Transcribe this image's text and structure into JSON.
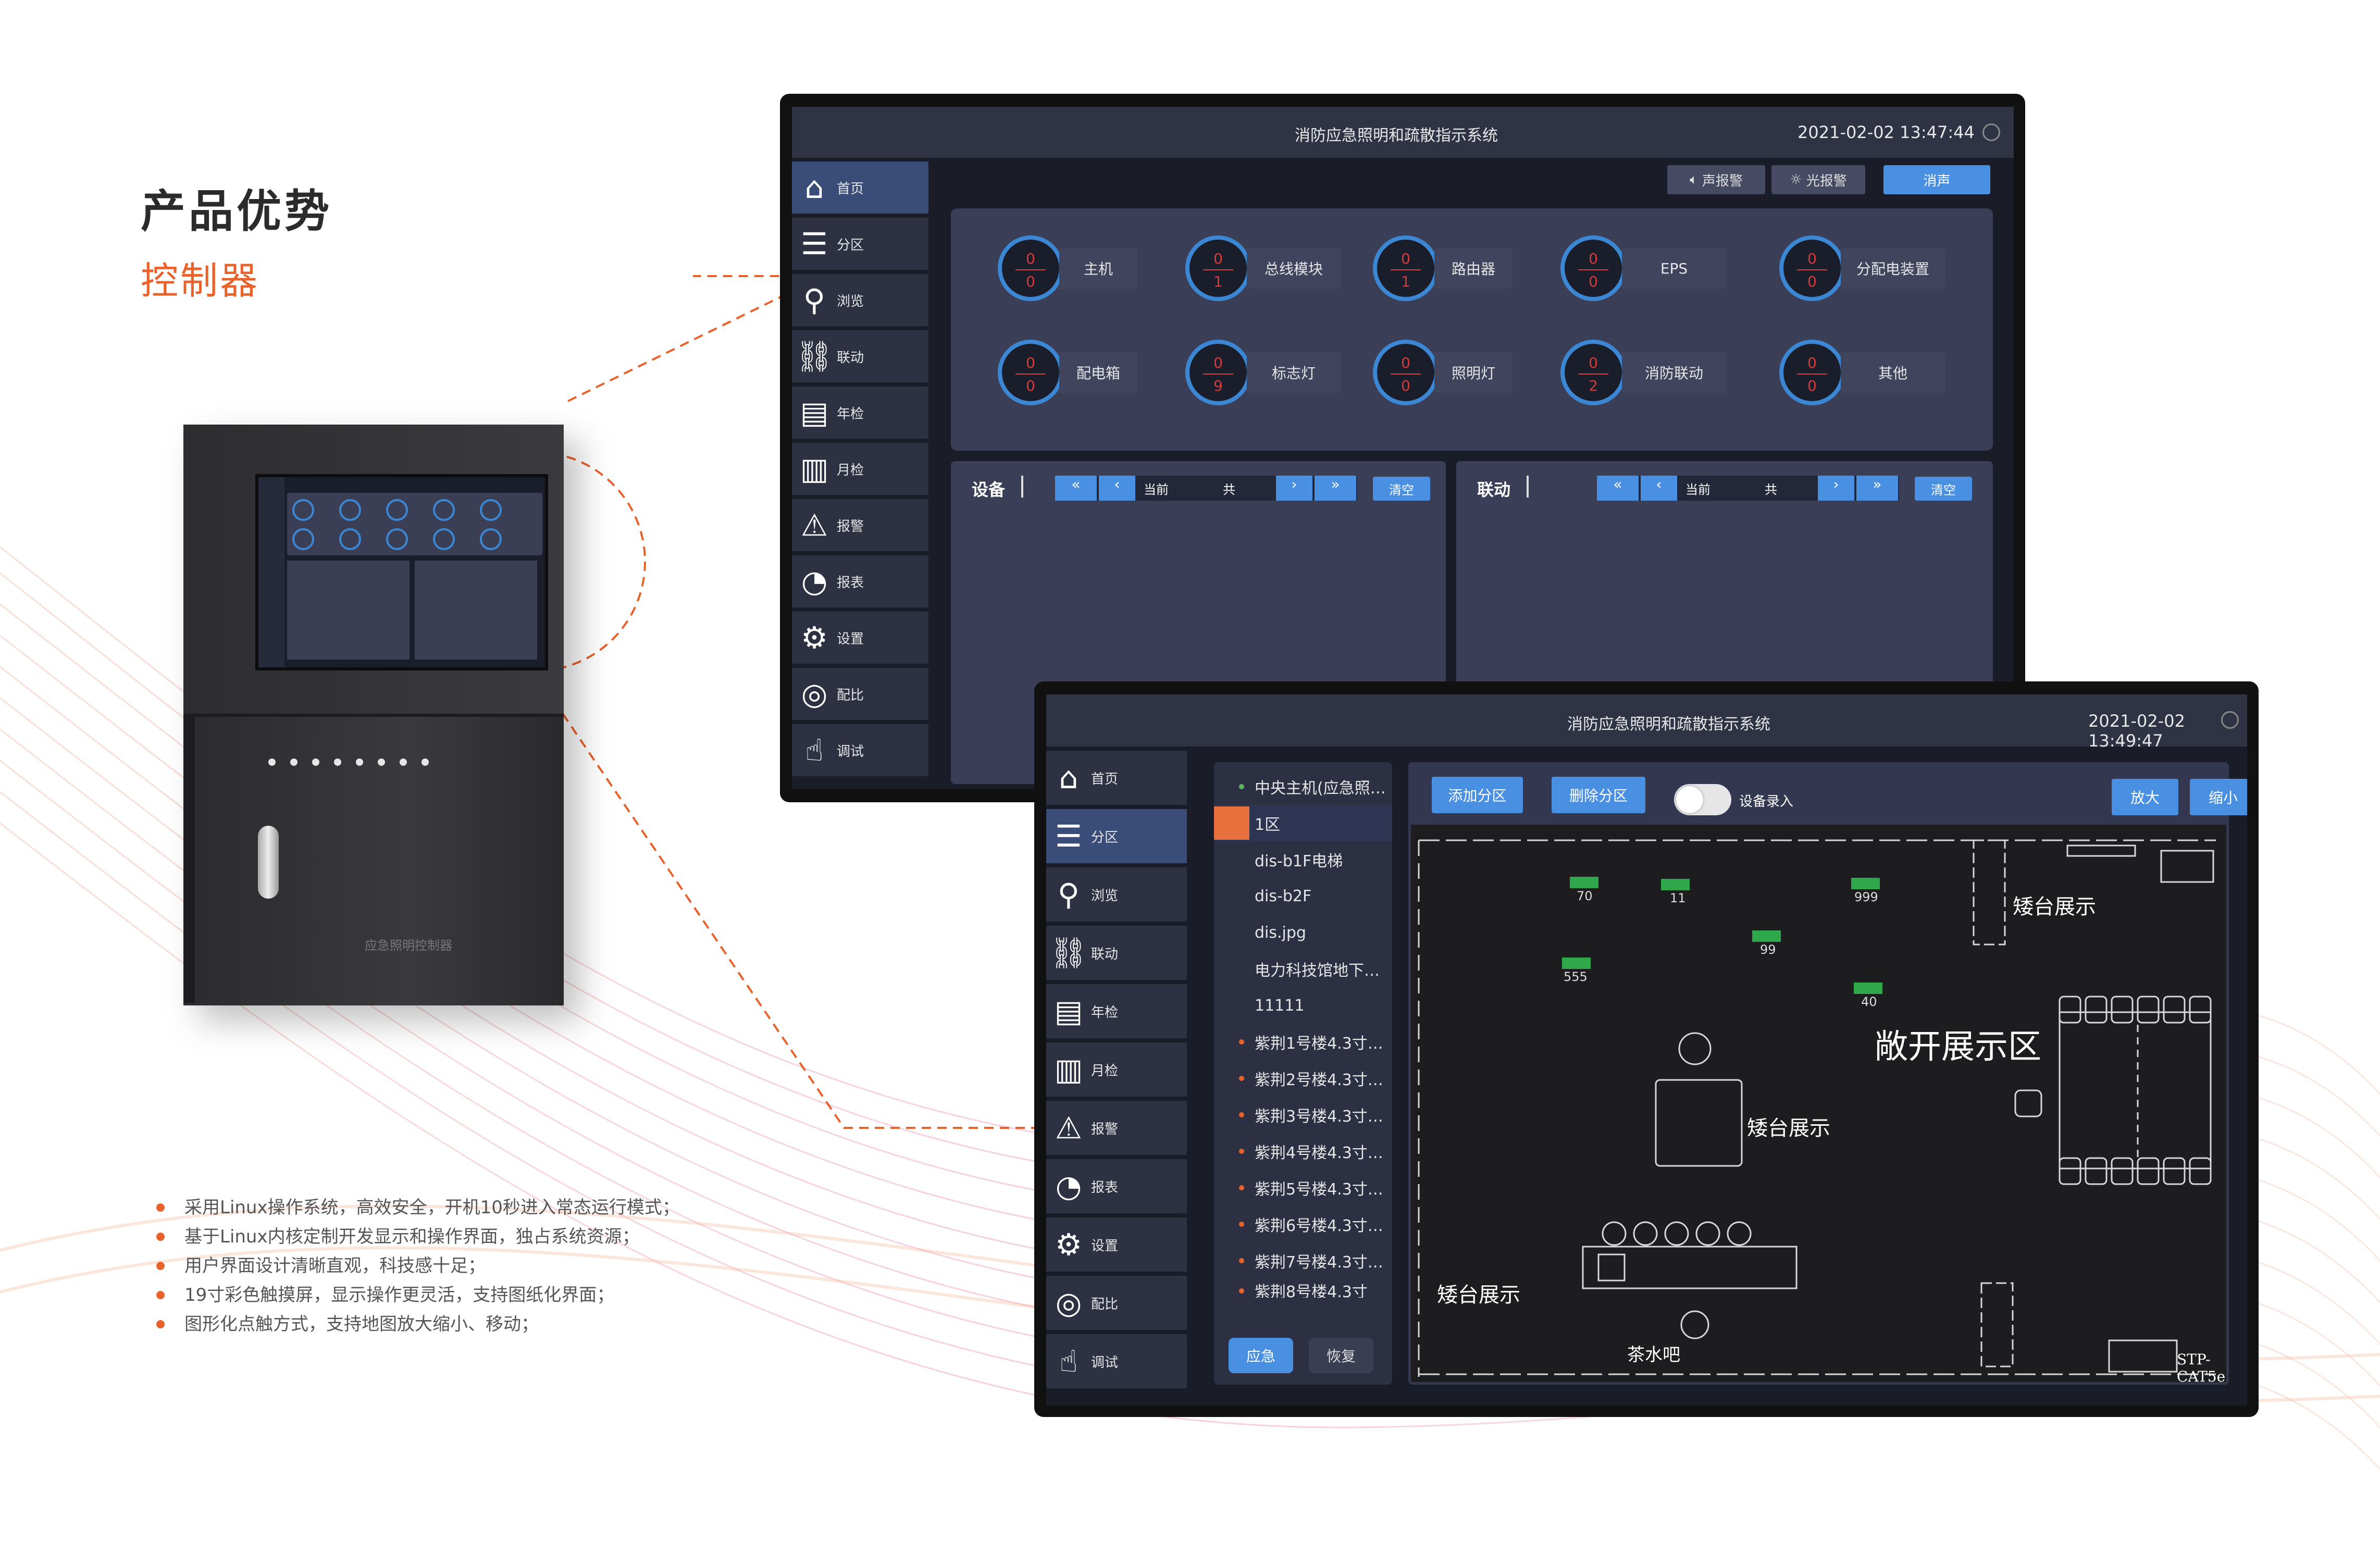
{
  "brochure": {
    "heading": "产品优势",
    "subheading": "控制器",
    "features": [
      "采用Linux操作系统，高效安全，开机10秒进入常态运行模式；",
      "基于Linux内核定制开发显示和操作界面，独占系统资源；",
      "用户界面设计清晰直观，科技感十足；",
      "19寸彩色触摸屏，显示操作更灵活，支持图纸化界面；",
      "图形化点触方式，支持地图放大缩小、移动；"
    ],
    "cabinet_label": "应急照明控制器",
    "accent_color": "#e8622c"
  },
  "screen1": {
    "title": "消防应急照明和疏散指示系统",
    "datetime": "2021-02-02 13:47:44",
    "alarm_buttons": {
      "sound": "声报警",
      "light": "光报警",
      "silence": "消声"
    },
    "nav": [
      {
        "icon": "home-icon",
        "glyph": "⌂",
        "label": "首页"
      },
      {
        "icon": "list-icon",
        "glyph": "☰",
        "label": "分区"
      },
      {
        "icon": "search-icon",
        "glyph": "⚲",
        "label": "浏览"
      },
      {
        "icon": "link-icon",
        "glyph": "⛓",
        "label": "联动"
      },
      {
        "icon": "document-icon",
        "glyph": "▤",
        "label": "年检"
      },
      {
        "icon": "document-icon",
        "glyph": "▥",
        "label": "月检"
      },
      {
        "icon": "warning-icon",
        "glyph": "⚠",
        "label": "报警"
      },
      {
        "icon": "pie-chart-icon",
        "glyph": "◔",
        "label": "报表"
      },
      {
        "icon": "gear-icon",
        "glyph": "⚙",
        "label": "设置"
      },
      {
        "icon": "radar-icon",
        "glyph": "◎",
        "label": "配比"
      },
      {
        "icon": "hand-icon",
        "glyph": "☝",
        "label": "调试"
      }
    ],
    "status_row1": [
      {
        "label": "主机",
        "top": "0",
        "bottom": "0"
      },
      {
        "label": "总线模块",
        "top": "0",
        "bottom": "1"
      },
      {
        "label": "路由器",
        "top": "0",
        "bottom": "1"
      },
      {
        "label": "EPS",
        "top": "0",
        "bottom": "0"
      },
      {
        "label": "分配电装置",
        "top": "0",
        "bottom": "0"
      }
    ],
    "status_row2": [
      {
        "label": "配电箱",
        "top": "0",
        "bottom": "0"
      },
      {
        "label": "标志灯",
        "top": "0",
        "bottom": "9"
      },
      {
        "label": "照明灯",
        "top": "0",
        "bottom": "0"
      },
      {
        "label": "消防联动",
        "top": "0",
        "bottom": "2"
      },
      {
        "label": "其他",
        "top": "0",
        "bottom": "0"
      }
    ],
    "device_panel": {
      "title": "设备",
      "first": "«",
      "prev": "‹",
      "current": "当前",
      "total": "共",
      "next": "›",
      "last": "»",
      "clear": "清空"
    },
    "link_panel": {
      "title": "联动",
      "first": "«",
      "prev": "‹",
      "current": "当前",
      "total": "共",
      "next": "›",
      "last": "»",
      "clear": "清空"
    }
  },
  "screen2": {
    "title": "消防应急照明和疏散指示系统",
    "datetime": "2021-02-02 13:49:47",
    "nav": [
      {
        "icon": "home-icon",
        "glyph": "⌂",
        "label": "首页"
      },
      {
        "icon": "list-icon",
        "glyph": "☰",
        "label": "分区"
      },
      {
        "icon": "search-icon",
        "glyph": "⚲",
        "label": "浏览"
      },
      {
        "icon": "link-icon",
        "glyph": "⛓",
        "label": "联动"
      },
      {
        "icon": "document-icon",
        "glyph": "▤",
        "label": "年检"
      },
      {
        "icon": "document-icon",
        "glyph": "▥",
        "label": "月检"
      },
      {
        "icon": "warning-icon",
        "glyph": "⚠",
        "label": "报警"
      },
      {
        "icon": "pie-chart-icon",
        "glyph": "◔",
        "label": "报表"
      },
      {
        "icon": "gear-icon",
        "glyph": "⚙",
        "label": "设置"
      },
      {
        "icon": "radar-icon",
        "glyph": "◎",
        "label": "配比"
      },
      {
        "icon": "hand-icon",
        "glyph": "☝",
        "label": "调试"
      }
    ],
    "tree": [
      {
        "label": "中央主机(应急照…",
        "dot": "#5cb85c"
      },
      {
        "label": "1区",
        "dot": ""
      },
      {
        "label": "dis-b1F电梯",
        "dot": ""
      },
      {
        "label": "dis-b2F",
        "dot": ""
      },
      {
        "label": "dis.jpg",
        "dot": ""
      },
      {
        "label": "电力科技馆地下…",
        "dot": ""
      },
      {
        "label": "11111",
        "dot": ""
      },
      {
        "label": "紫荆1号楼4.3寸…",
        "dot": "#e8622c"
      },
      {
        "label": "紫荆2号楼4.3寸…",
        "dot": "#e8622c"
      },
      {
        "label": "紫荆3号楼4.3寸…",
        "dot": "#e8622c"
      },
      {
        "label": "紫荆4号楼4.3寸…",
        "dot": "#e8622c"
      },
      {
        "label": "紫荆5号楼4.3寸…",
        "dot": "#e8622c"
      },
      {
        "label": "紫荆6号楼4.3寸…",
        "dot": "#e8622c"
      },
      {
        "label": "紫荆7号楼4.3寸…",
        "dot": "#e8622c"
      },
      {
        "label": "紫荆8号楼4.3寸",
        "dot": "#e8622c"
      }
    ],
    "tree_buttons": {
      "emergency": "应急",
      "restore": "恢复"
    },
    "toolbar": {
      "add": "添加分区",
      "delete": "删除分区",
      "toggle_label": "设备录入",
      "zoom_in": "放大",
      "zoom_out": "缩小"
    },
    "map_labels": {
      "open_area": "敞开展示区",
      "low_display_1": "矮台展示",
      "low_display_2": "矮台展示",
      "low_display_3": "矮台展示",
      "tea_bar": "茶水吧",
      "cable": "STP-CAT5e"
    },
    "exit_signs": [
      "70",
      "11",
      "999",
      "99",
      "555",
      "40"
    ]
  }
}
